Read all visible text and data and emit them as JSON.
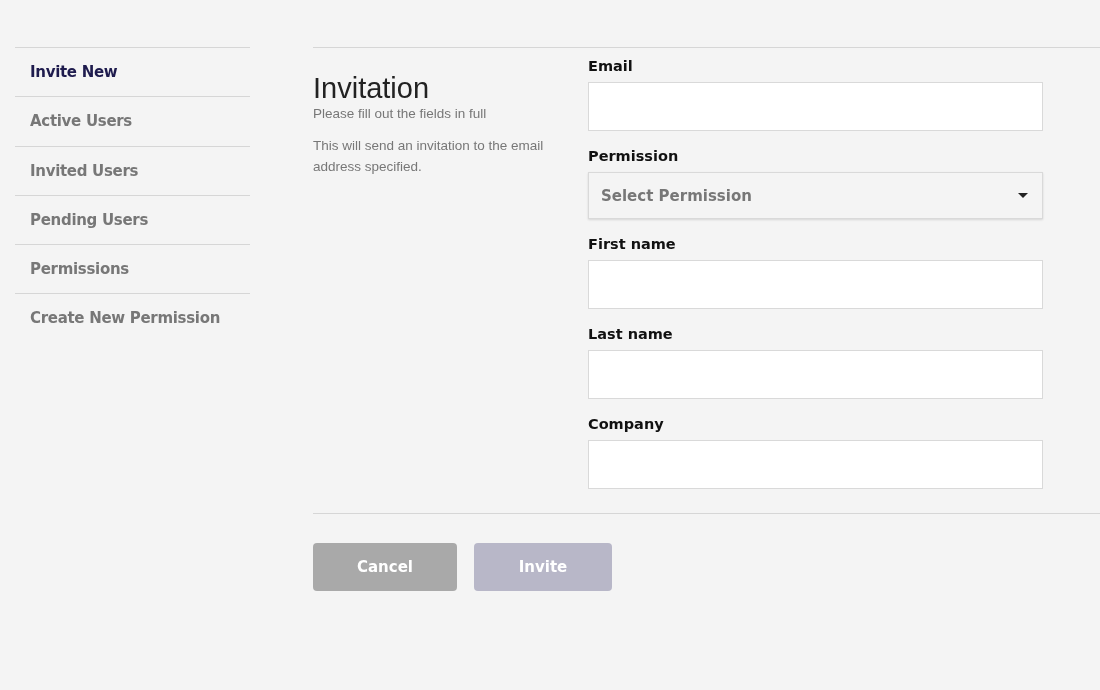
{
  "sidebar": {
    "items": [
      {
        "label": "Invite New",
        "selected": true
      },
      {
        "label": "Active Users",
        "selected": false
      },
      {
        "label": "Invited Users",
        "selected": false
      },
      {
        "label": "Pending Users",
        "selected": false
      },
      {
        "label": "Permissions",
        "selected": false
      },
      {
        "label": "Create New Permission",
        "selected": false
      }
    ]
  },
  "intro": {
    "title": "Invitation",
    "subtitle": "Please fill out the fields in full",
    "description": "This will send an invitation to the email address specified."
  },
  "form": {
    "fields": [
      {
        "kind": "text",
        "label": "Email"
      },
      {
        "kind": "select",
        "label": "Permission",
        "placeholder": "Select Permission"
      },
      {
        "kind": "text",
        "label": "First name"
      },
      {
        "kind": "text",
        "label": "Last name"
      },
      {
        "kind": "text",
        "label": "Company"
      }
    ]
  },
  "buttons": [
    {
      "kind": "secondary",
      "label": "Cancel",
      "disabled": false
    },
    {
      "kind": "primary",
      "label": "Invite",
      "disabled": true
    }
  ]
}
